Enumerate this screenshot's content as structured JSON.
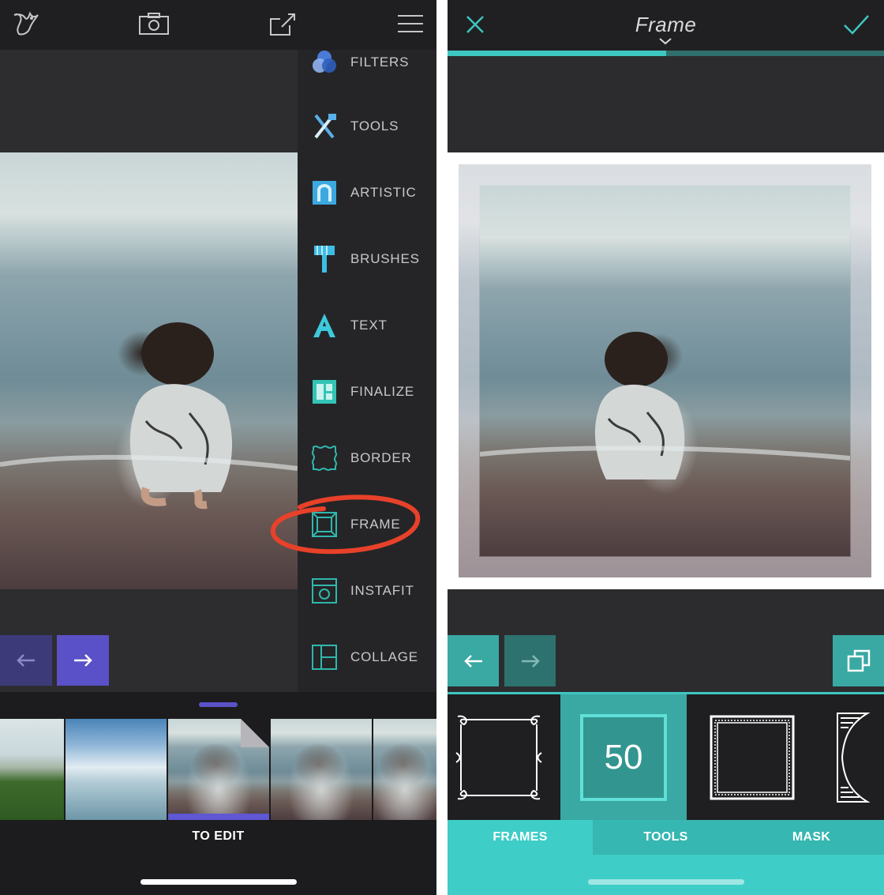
{
  "left_screen": {
    "menu": {
      "items": [
        {
          "label": "FILTERS",
          "icon": "filters-icon"
        },
        {
          "label": "TOOLS",
          "icon": "tools-icon"
        },
        {
          "label": "ARTISTIC",
          "icon": "artistic-icon"
        },
        {
          "label": "BRUSHES",
          "icon": "brushes-icon"
        },
        {
          "label": "TEXT",
          "icon": "text-icon"
        },
        {
          "label": "FINALIZE",
          "icon": "finalize-icon"
        },
        {
          "label": "BORDER",
          "icon": "border-icon"
        },
        {
          "label": "FRAME",
          "icon": "frame-icon",
          "highlighted": true
        },
        {
          "label": "INSTAFIT",
          "icon": "instafit-icon"
        },
        {
          "label": "COLLAGE",
          "icon": "collage-icon"
        }
      ]
    },
    "strip": {
      "caption": "TO EDIT"
    }
  },
  "right_screen": {
    "title": "Frame",
    "progress": 0.5,
    "frame_value": "50",
    "tabs": [
      "FRAMES",
      "TOOLS",
      "MASK"
    ],
    "active_tab": "FRAMES"
  },
  "colors": {
    "accent_purple": "#6057d4",
    "accent_teal": "#3ecdc7",
    "annotation_red": "#e8412a"
  }
}
